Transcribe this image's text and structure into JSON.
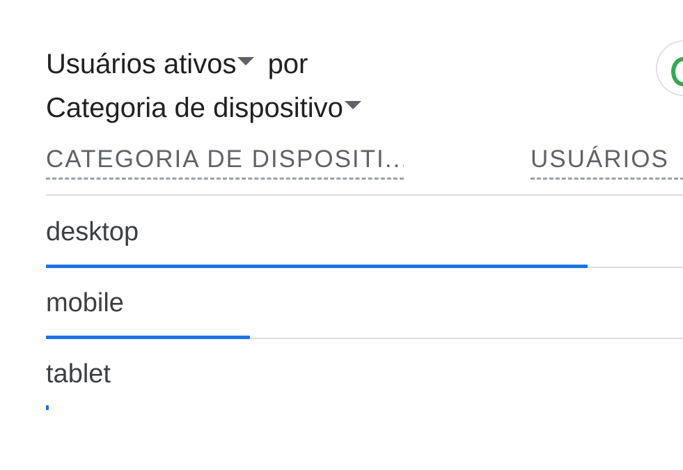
{
  "card": {
    "metric_label": "Usuários ativos",
    "by_label": "por",
    "dimension_label": "Categoria de dispositivo"
  },
  "table": {
    "headers": {
      "dimension": "CATEGORIA DE DISPOSITI...",
      "metric": "USUÁRIOS"
    },
    "rows": [
      {
        "label": "desktop",
        "share": 0.85
      },
      {
        "label": "mobile",
        "share": 0.32
      },
      {
        "label": "tablet",
        "share": 0.004
      }
    ]
  },
  "colors": {
    "bar": "#1a73e8",
    "compare_icon": "#34a853"
  },
  "icons": {
    "compare": "compare-circle-icon",
    "dropdown": "caret-down-icon"
  }
}
